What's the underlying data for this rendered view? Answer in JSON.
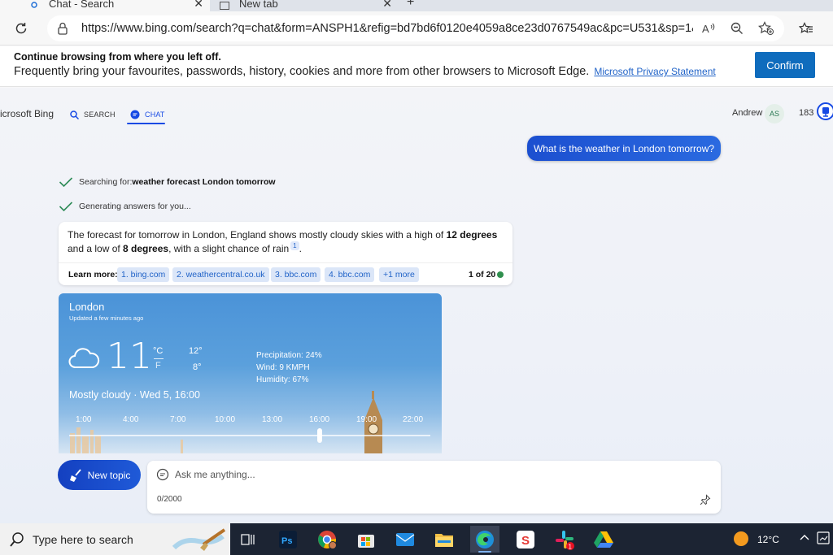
{
  "browser": {
    "tabs": [
      {
        "label": "Chat - Search",
        "active": true
      },
      {
        "label": "New tab",
        "active": false
      }
    ],
    "url": "https://www.bing.com/search?q=chat&form=ANSPH1&refig=bd7bd6f0120e4059a8ce23d0767549ac&pc=U531&sp=1&lq=..."
  },
  "banner": {
    "title": "Continue browsing from where you left off.",
    "text": "Frequently bring your favourites, passwords, history, cookies and more from other browsers to Microsoft Edge.",
    "link": "Microsoft Privacy Statement",
    "confirm": "Confirm"
  },
  "nav": {
    "brand": "icrosoft Bing",
    "search_tab": "SEARCH",
    "chat_tab": "CHAT",
    "user_name": "Andrew",
    "user_initials": "AS",
    "rewards": "183"
  },
  "chat": {
    "user_message": "What is the weather in London tomorrow?",
    "step1_prefix": "Searching for: ",
    "step1_query": "weather forecast London tomorrow",
    "step2": "Generating answers for you...",
    "answer": {
      "p1": "The forecast for tomorrow in London, England shows mostly cloudy skies with a high of ",
      "b1": "12 degrees",
      "p2": " and a low of ",
      "b2": "8 degrees",
      "p3": ", with a slight chance of rain",
      "cite": "1",
      "p4": "."
    },
    "learn_more_label": "Learn more:",
    "sources": [
      "1. bing.com",
      "2. weathercentral.co.uk",
      "3. bbc.com",
      "4. bbc.com",
      "+1 more"
    ],
    "page_count": "1 of 20"
  },
  "weather": {
    "city": "London",
    "updated": "Updated a few minutes ago",
    "temp": "11",
    "unit_c": "°C",
    "unit_f": "F",
    "high": "12°",
    "low": "8°",
    "precipitation": "Precipitation: 24%",
    "wind": "Wind: 9 KMPH",
    "humidity": "Humidity: 67%",
    "condition": "Mostly cloudy · Wed 5, 16:00",
    "hours": [
      "1:00",
      "4:00",
      "7:00",
      "10:00",
      "13:00",
      "16:00",
      "19:00",
      "22:00"
    ],
    "selected_hour": "16:00"
  },
  "composer": {
    "new_topic": "New topic",
    "placeholder": "Ask me anything...",
    "count": "0/2000"
  },
  "taskbar": {
    "search_placeholder": "Type here to search",
    "weather": "12°C",
    "icons": [
      "task-view-icon",
      "photoshop-icon",
      "chrome-icon",
      "microsoft-store-icon",
      "mail-icon",
      "file-explorer-icon",
      "edge-icon",
      "app-s-icon",
      "slack-icon",
      "google-drive-icon"
    ],
    "badge": "1",
    "brand_colors": {
      "bing_blue": "#174ae4",
      "edge_blue": "#0f6cbd",
      "taskbar": "#1c2433"
    }
  }
}
